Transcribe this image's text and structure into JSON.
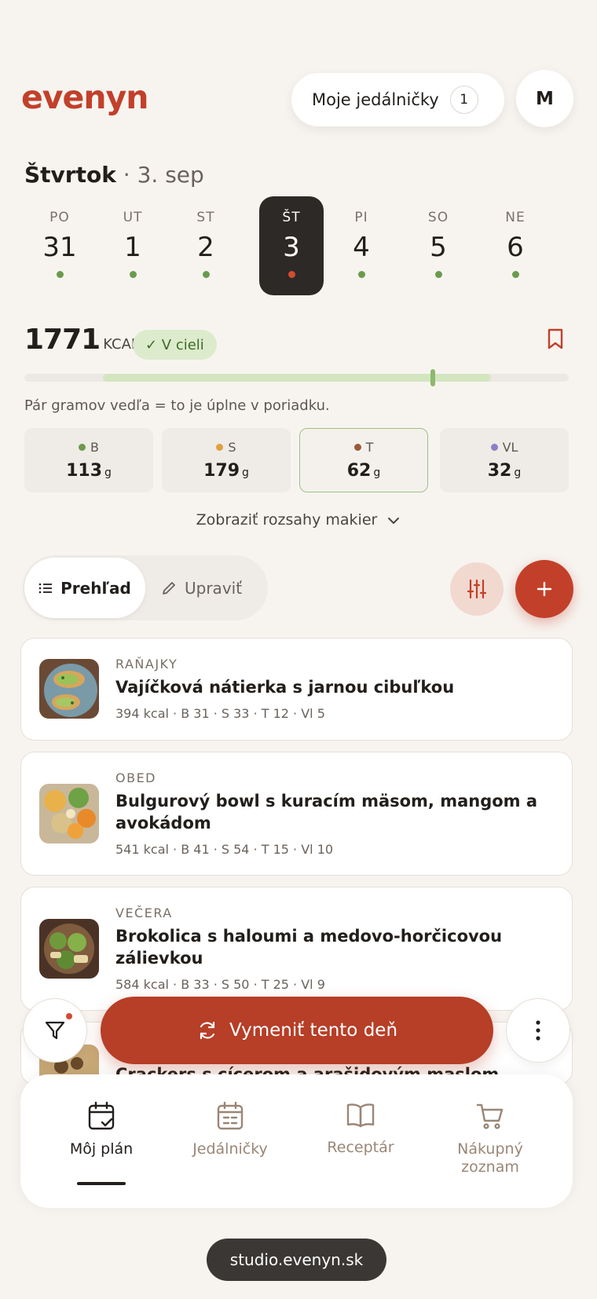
{
  "header": {
    "logo": "evenyn",
    "plans_label": "Moje jedálničky",
    "plans_count": "1",
    "avatar_initial": "M"
  },
  "date": {
    "day": "Štvrtok",
    "separator": "·",
    "date": "3. sep"
  },
  "week": [
    {
      "label": "PO",
      "num": "31",
      "selected": false
    },
    {
      "label": "UT",
      "num": "1",
      "selected": false
    },
    {
      "label": "ST",
      "num": "2",
      "selected": false
    },
    {
      "label": "ŠT",
      "num": "3",
      "selected": true
    },
    {
      "label": "PI",
      "num": "4",
      "selected": false
    },
    {
      "label": "SO",
      "num": "5",
      "selected": false
    },
    {
      "label": "NE",
      "num": "6",
      "selected": false
    }
  ],
  "calories": {
    "value": "1771",
    "unit": "KCAL",
    "status": "✓ V cieli",
    "progress_fraction": 0.75,
    "hint": "Pár gramov vedľa = to je úplne v poriadku."
  },
  "macros": [
    {
      "label": "B",
      "value": "113",
      "unit": "g",
      "color": "#6b9a4f",
      "selected": false
    },
    {
      "label": "S",
      "value": "179",
      "unit": "g",
      "color": "#e0a040",
      "selected": false
    },
    {
      "label": "T",
      "value": "62",
      "unit": "g",
      "color": "#9a5a3a",
      "selected": true
    },
    {
      "label": "VL",
      "value": "32",
      "unit": "g",
      "color": "#8a80c8",
      "selected": false
    }
  ],
  "show_ranges": "Zobraziť rozsahy makier",
  "toolbar": {
    "overview": "Prehľad",
    "edit": "Upraviť"
  },
  "meals": [
    {
      "type": "RAŇAJKY",
      "name": "Vajíčková nátierka s jarnou cibuľkou",
      "meta": "394 kcal · B 31 · S 33 · T 12 · Vl 5"
    },
    {
      "type": "OBED",
      "name": "Bulgurový bowl s kuracím mäsom, mangom a avokádom",
      "meta": "541 kcal · B 41 · S 54 · T 15 · Vl 10"
    },
    {
      "type": "VEČERA",
      "name": "Brokolica s haloumi a medovo-horčicovou zálievkou",
      "meta": "584 kcal · B 33 · S 50 · T 25 · Vl 9"
    },
    {
      "type": "",
      "name": "Crackers s cícerom a arašidovým maslom",
      "meta": ""
    }
  ],
  "actions": {
    "swap_day": "Vymeniť tento deň"
  },
  "nav": [
    {
      "label": "Môj plán",
      "icon": "calendar-check-icon",
      "active": true
    },
    {
      "label": "Jedálničky",
      "icon": "calendar-list-icon",
      "active": false
    },
    {
      "label": "Receptár",
      "icon": "book-icon",
      "active": false
    },
    {
      "label": "Nákupný zoznam",
      "icon": "cart-icon",
      "active": false
    }
  ],
  "url": "studio.evenyn.sk",
  "colors": {
    "brand": "#c2402a",
    "accent_green": "#6b9a4f",
    "background": "#f7f4f0"
  }
}
